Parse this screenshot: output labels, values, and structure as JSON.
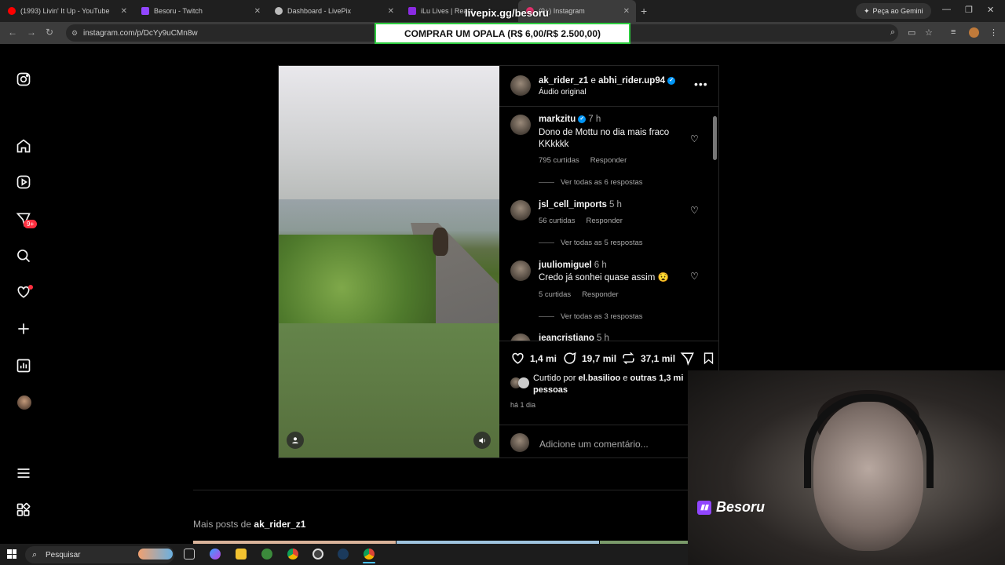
{
  "browser": {
    "tabs": [
      {
        "title": "(1993) Livin' It Up - YouTube",
        "color": "#ff0000"
      },
      {
        "title": "Besoru - Twitch",
        "color": "#9146ff"
      },
      {
        "title": "Dashboard - LivePix",
        "color": "#cccccc"
      },
      {
        "title": "iLu Lives | React",
        "color": "#8a2be2"
      },
      {
        "title": "(9+) Instagram",
        "color": "#e1306c"
      }
    ],
    "gemini_label": "Peça ao Gemini",
    "url": "instagram.com/p/DcYy9uCMn8w"
  },
  "overlay": {
    "livepix_title": "livepix.gg/besoru",
    "livepix_banner": "COMPRAR UM OPALA (R$ 6,00/R$ 2.500,00)"
  },
  "sidebar": {
    "badge": "9+"
  },
  "post": {
    "author1": "ak_rider_z1",
    "conjunction": "e",
    "author2": "abhi_rider.up94",
    "audio": "Áudio original",
    "comments": [
      {
        "user": "markzitu",
        "verified": true,
        "time": "7 h",
        "text": "Dono de Mottu no dia mais fraco KKkkkk",
        "likes": "795 curtidas",
        "reply": "Responder",
        "replies": "Ver todas as 6 respostas"
      },
      {
        "user": "jsl_cell_imports",
        "verified": false,
        "time": "5 h",
        "text": "",
        "likes": "56 curtidas",
        "reply": "Responder",
        "replies": "Ver todas as 5 respostas"
      },
      {
        "user": "juuliomiguel",
        "verified": false,
        "time": "6 h",
        "text": "Credo já sonhei quase assim 😧",
        "likes": "5 curtidas",
        "reply": "Responder",
        "replies": "Ver todas as 3 respostas"
      },
      {
        "user": "jeancristiano",
        "verified": false,
        "time": "5 h"
      }
    ],
    "like_count": "1,4 mi",
    "comment_count": "19,7 mil",
    "repost_count": "37,1 mil",
    "liked_prefix": "Curtido por",
    "liked_user": "el.basilioo",
    "liked_and": "e",
    "liked_others": "outras 1,3 mi pessoas",
    "posted_ago": "há 1 dia",
    "add_comment_placeholder": "Adicione um comentário..."
  },
  "more_posts": {
    "prefix": "Mais posts de",
    "user": "ak_rider_z1"
  },
  "stream": {
    "channel": "Besoru"
  },
  "taskbar": {
    "search_label": "Pesquisar"
  }
}
